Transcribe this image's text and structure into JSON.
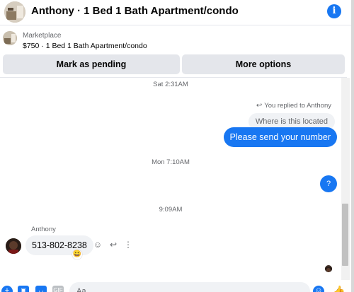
{
  "header": {
    "title": "Anthony · 1 Bed 1 Bath Apartment/condo",
    "info_icon": "info-icon"
  },
  "listing": {
    "source": "Marketplace",
    "price_title": "$750 · 1 Bed 1 Bath Apartment/condo"
  },
  "actions": {
    "pending_label": "Mark as pending",
    "more_label": "More options"
  },
  "thread": {
    "ts1": "Sat 2:31AM",
    "reply_note": "You replied to Anthony",
    "quoted_text": "Where is this located",
    "outgoing_1": "Please send your number",
    "ts2": "Mon 7:10AM",
    "outgoing_2": "?",
    "ts3": "9:09AM",
    "sender_name": "Anthony",
    "incoming_1": "513-802-8238",
    "reaction": "😀"
  },
  "composer": {
    "placeholder": "Aa"
  },
  "colors": {
    "accent": "#1877f2",
    "bubble_in": "#f0f2f5",
    "button_bg": "#e4e6eb"
  }
}
